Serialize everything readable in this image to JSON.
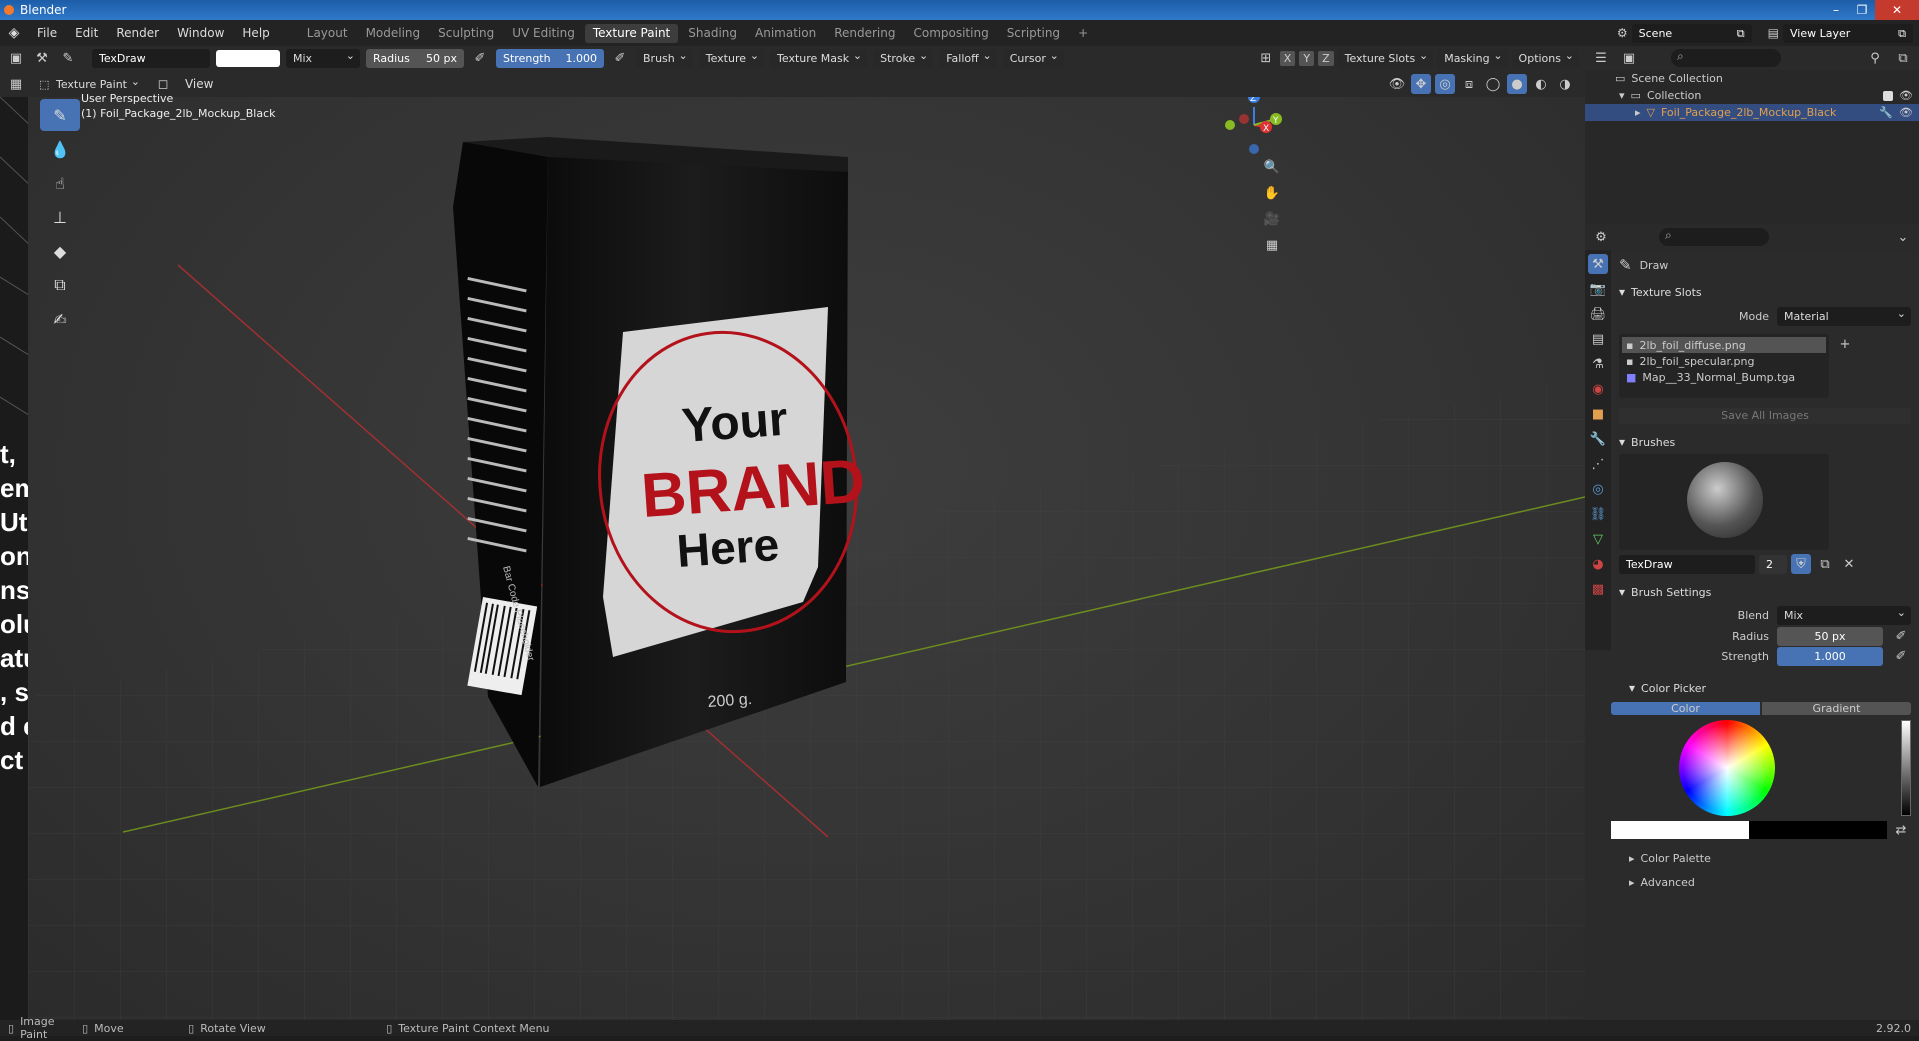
{
  "titlebar": {
    "title": "Blender"
  },
  "menu": {
    "items": [
      "File",
      "Edit",
      "Render",
      "Window",
      "Help"
    ]
  },
  "workspaces": [
    "Layout",
    "Modeling",
    "Sculpting",
    "UV Editing",
    "Texture Paint",
    "Shading",
    "Animation",
    "Rendering",
    "Compositing",
    "Scripting"
  ],
  "workspace_plus": "+",
  "scene": {
    "label": "Scene",
    "view_layer": "View Layer"
  },
  "toolhdr": {
    "brush_name": "TexDraw",
    "blend": "Mix",
    "radius_label": "Radius",
    "radius_value": "50 px",
    "strength_label": "Strength",
    "strength_value": "1.000",
    "menus": [
      "Brush",
      "Texture",
      "Texture Mask",
      "Stroke",
      "Falloff",
      "Cursor"
    ],
    "axes": [
      "X",
      "Y",
      "Z"
    ],
    "right_menus": [
      "Texture Slots",
      "Masking",
      "Options"
    ]
  },
  "hdr2": {
    "mode": "Texture Paint",
    "view": "View"
  },
  "viewport": {
    "perspective": "User Perspective",
    "object": "(1) Foil_Package_2lb_Mockup_Black",
    "brand_your": "Your",
    "brand_brand": "BRAND",
    "brand_here": "Here",
    "weight": "200 g.",
    "barcode": "Bar Code Placeholder",
    "gizmo": {
      "x": "X",
      "y": "Y",
      "z": "Z"
    }
  },
  "outliner": {
    "scene_collection": "Scene Collection",
    "collection": "Collection",
    "object": "Foil_Package_2lb_Mockup_Black"
  },
  "props": {
    "tool_name": "Draw",
    "texture_slots": "Texture Slots",
    "mode_label": "Mode",
    "mode_value": "Material",
    "slots": [
      "2lb_foil_diffuse.png",
      "2lb_foil_specular.png",
      "Map__33_Normal_Bump.tga"
    ],
    "save_all": "Save All Images",
    "brushes": "Brushes",
    "brush_name": "TexDraw",
    "brush_users": "2",
    "brush_settings": "Brush Settings",
    "blend_label": "Blend",
    "blend_value": "Mix",
    "radius_label": "Radius",
    "radius_value": "50 px",
    "strength_label": "Strength",
    "strength_value": "1.000",
    "color_picker": "Color Picker",
    "color_tab": "Color",
    "gradient_tab": "Gradient",
    "color_palette": "Color Palette",
    "advanced": "Advanced"
  },
  "status": {
    "image_paint": "Image Paint",
    "move": "Move",
    "rotate": "Rotate View",
    "context": "Texture Paint Context Menu",
    "version": "2.92.0"
  },
  "leftstrip_text": [
    "t,",
    "em",
    "Ut",
    "on",
    "ns",
    "olu",
    "atu",
    ", s",
    "d e",
    "ct"
  ],
  "colors": {
    "accent": "#4772b3",
    "titlebar": "#2f79c9",
    "brand_red": "#b3121b",
    "active_item": "#e0a050"
  }
}
